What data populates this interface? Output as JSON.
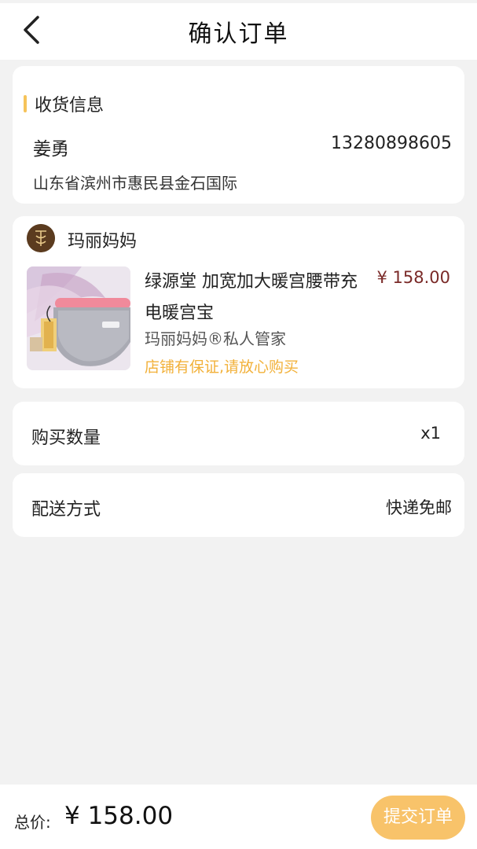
{
  "header": {
    "title": "确认订单",
    "back_icon": "chevron-left-icon"
  },
  "receiver": {
    "section_title": "收货信息",
    "name": "姜勇",
    "phone": "13280898605",
    "address": "山东省滨州市惠民县金石国际"
  },
  "shop": {
    "name": "玛丽妈妈",
    "logo_icon": "shop-logo"
  },
  "product": {
    "title": "绿源堂 加宽加大暖宫腰带充电暖宫宝",
    "price": "¥ 158.00",
    "seller": "玛丽妈妈®私人管家",
    "guarantee": "店铺有保证,请放心购买"
  },
  "quantity": {
    "label": "购买数量",
    "value": "x1"
  },
  "delivery": {
    "label": "配送方式",
    "value": "快递免邮"
  },
  "footer": {
    "total_label": "总价:",
    "total_amount": "¥ 158.00",
    "submit_label": "提交订单"
  },
  "colors": {
    "accent": "#f6c35a",
    "price": "#7a2a28",
    "submit_bg": "#f8c36a"
  }
}
